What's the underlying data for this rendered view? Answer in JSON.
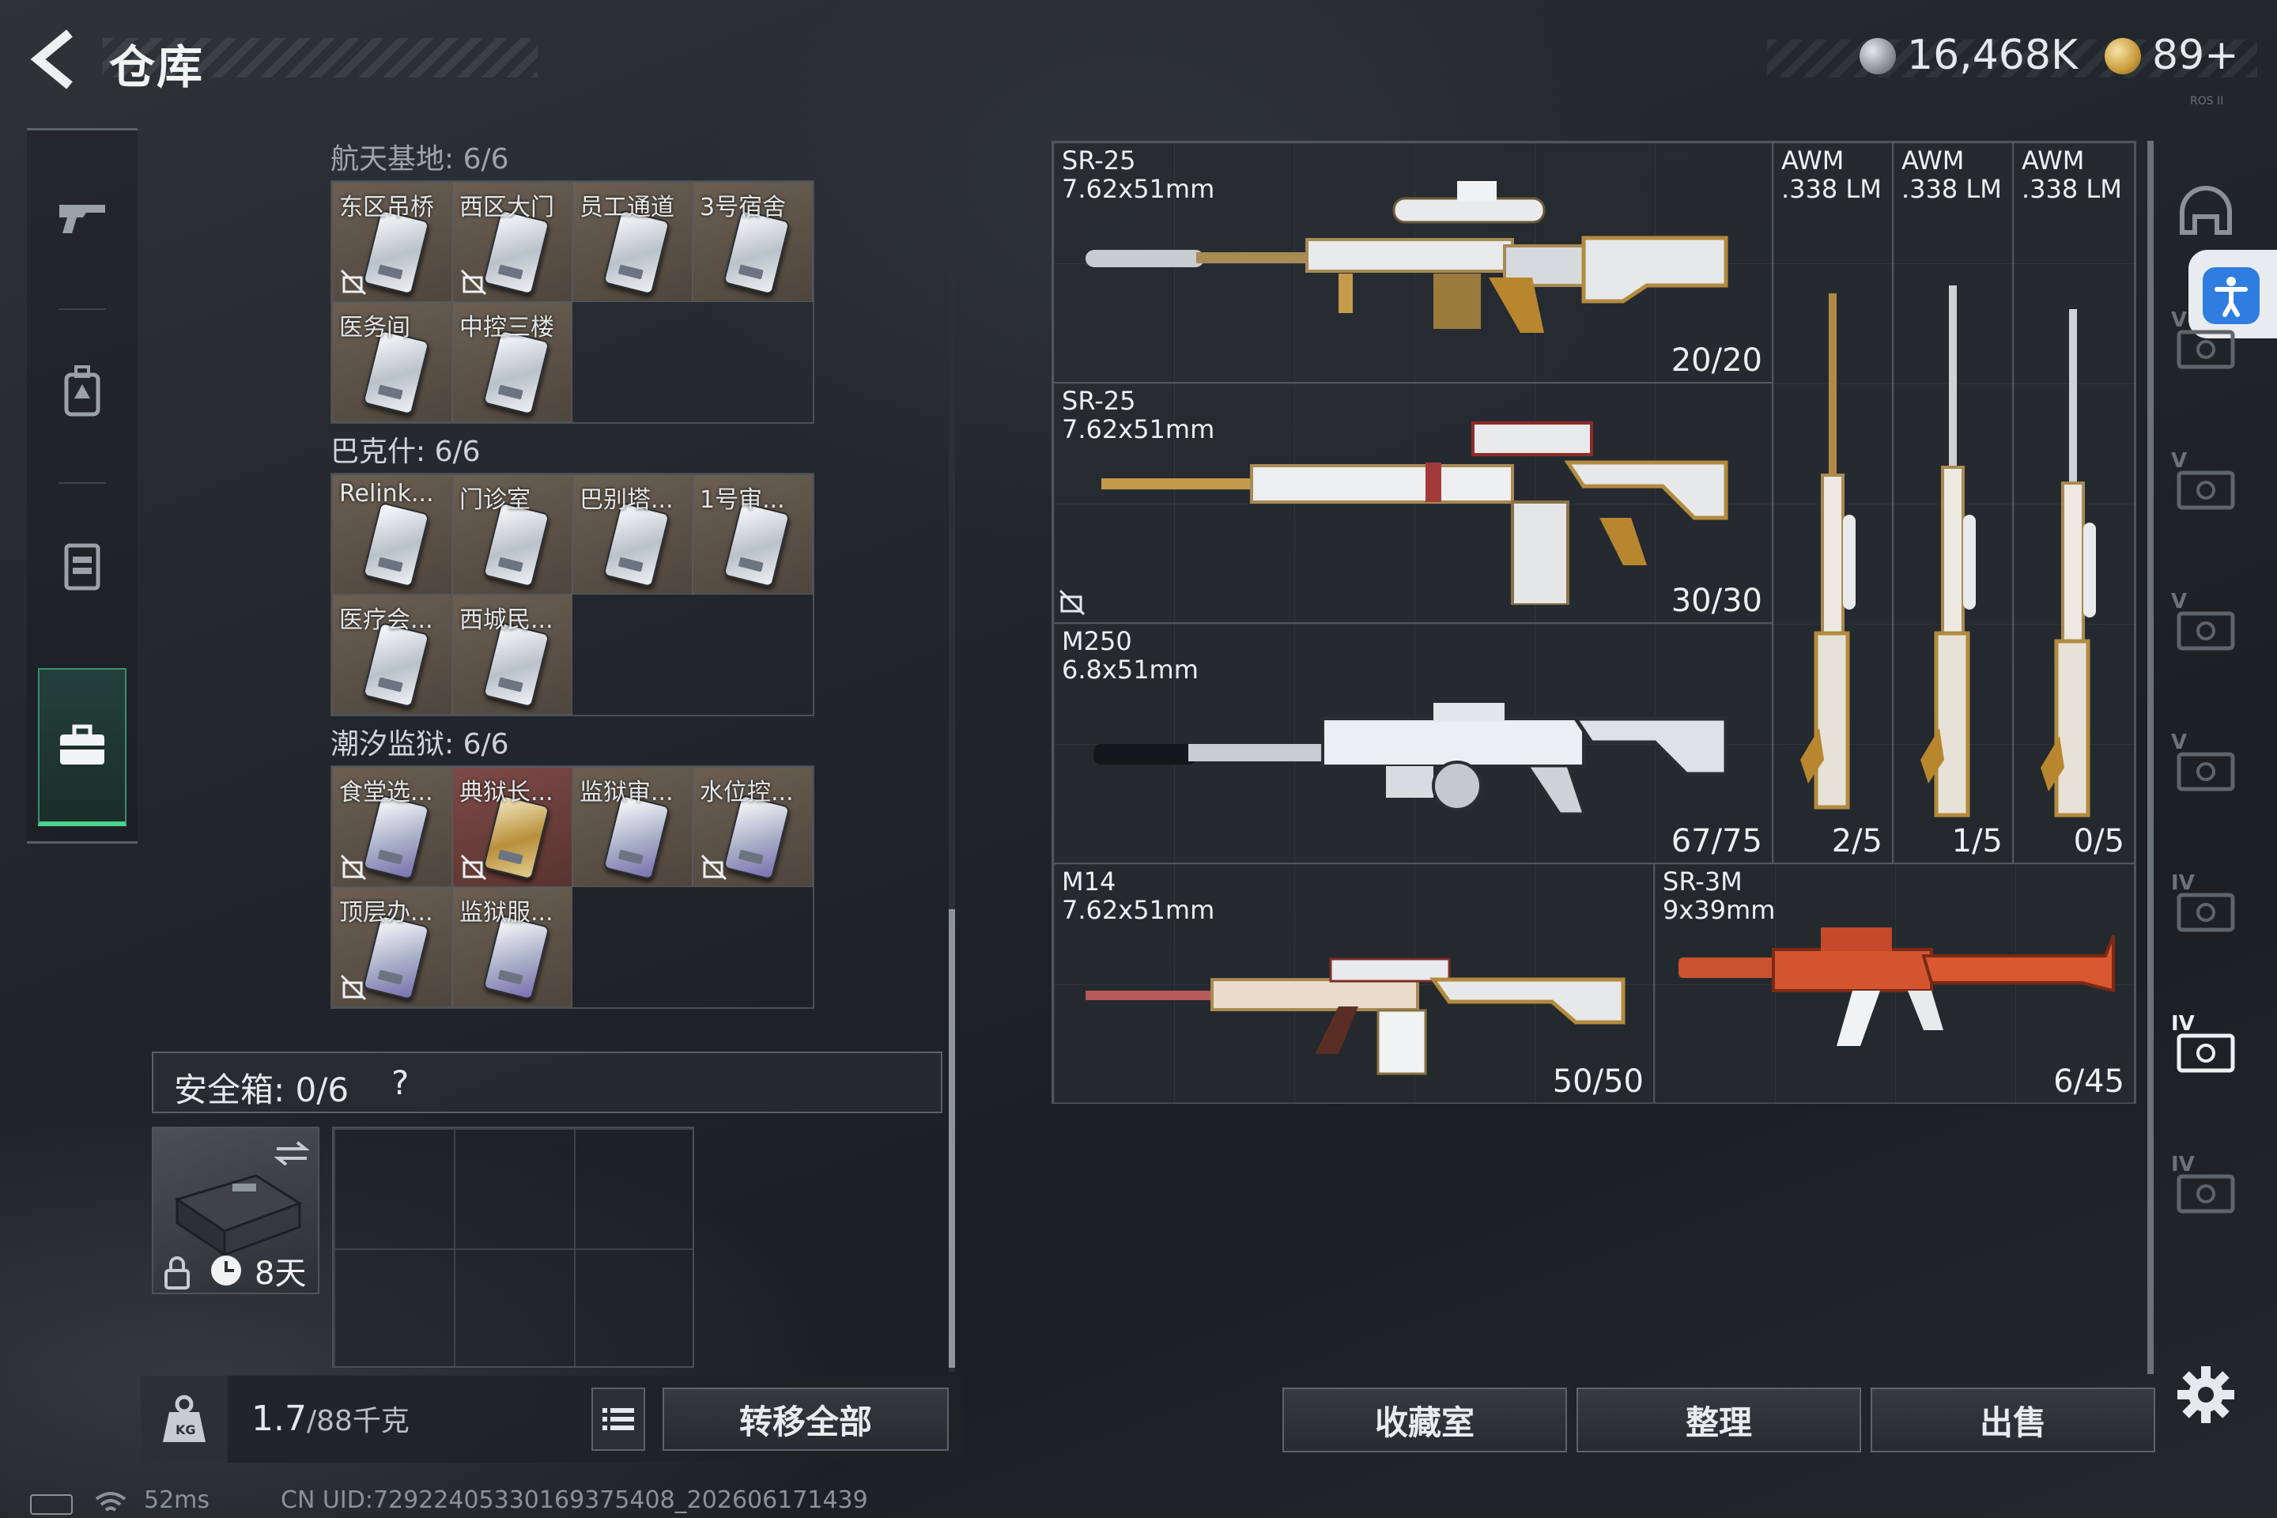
{
  "header": {
    "title": "仓库",
    "currency_main": "16,468K",
    "currency_premium": "89+",
    "small_code": "ROS II"
  },
  "nav": {
    "items": [
      "gun-icon",
      "backpack-icon",
      "vest-icon",
      "briefcase-icon"
    ],
    "active": "briefcase-icon"
  },
  "stash": {
    "sections": [
      {
        "title": "航天基地: 6/6",
        "keys": [
          {
            "label": "东区吊桥",
            "card": "white",
            "bg": "brown",
            "nosym": true
          },
          {
            "label": "西区大门",
            "card": "white",
            "bg": "brown",
            "nosym": true
          },
          {
            "label": "员工通道",
            "card": "white",
            "bg": "brown",
            "nosym": false
          },
          {
            "label": "3号宿舍",
            "card": "white",
            "bg": "brown",
            "nosym": false
          },
          {
            "label": "医务间",
            "card": "white",
            "bg": "brown",
            "nosym": false
          },
          {
            "label": "中控三楼",
            "card": "white",
            "bg": "brown",
            "nosym": false
          }
        ]
      },
      {
        "title": "巴克什: 6/6",
        "keys": [
          {
            "label": "Relink...",
            "card": "white",
            "bg": "brown",
            "nosym": false
          },
          {
            "label": "门诊室",
            "card": "white",
            "bg": "brown",
            "nosym": false
          },
          {
            "label": "巴别塔...",
            "card": "white",
            "bg": "brown",
            "nosym": false
          },
          {
            "label": "1号审...",
            "card": "white",
            "bg": "brown",
            "nosym": false
          },
          {
            "label": "医疗会...",
            "card": "white",
            "bg": "brown",
            "nosym": false
          },
          {
            "label": "西城民...",
            "card": "white",
            "bg": "brown",
            "nosym": false
          }
        ]
      },
      {
        "title": "潮汐监狱: 6/6",
        "keys": [
          {
            "label": "食堂选...",
            "card": "purple",
            "bg": "brown",
            "nosym": true
          },
          {
            "label": "典狱长...",
            "card": "gold",
            "bg": "red",
            "nosym": true
          },
          {
            "label": "监狱审...",
            "card": "purple",
            "bg": "brown",
            "nosym": false
          },
          {
            "label": "水位控...",
            "card": "purple",
            "bg": "brown",
            "nosym": true
          },
          {
            "label": "顶层办...",
            "card": "purple",
            "bg": "brown",
            "nosym": true
          },
          {
            "label": "监狱服...",
            "card": "purple",
            "bg": "brown",
            "nosym": false
          }
        ]
      }
    ],
    "secure_box": {
      "label": "安全箱: 0/6",
      "help": "?",
      "timer": "8天"
    },
    "weight": {
      "value": "1.7",
      "max": "/88千克"
    },
    "transfer_all": "转移全部"
  },
  "weapons": [
    {
      "name": "SR-25",
      "caliber": "7.62x51mm",
      "ammo": "20/20",
      "style": "gold"
    },
    {
      "name": "SR-25",
      "caliber": "7.62x51mm",
      "ammo": "30/30",
      "style": "gold"
    },
    {
      "name": "M250",
      "caliber": "6.8x51mm",
      "ammo": "67/75",
      "style": "white"
    },
    {
      "name": "M14",
      "caliber": "7.62x51mm",
      "ammo": "50/50",
      "style": "gold"
    },
    {
      "name": "SR-3M",
      "caliber": "9x39mm",
      "ammo": "6/45",
      "style": "red"
    },
    {
      "name": "AWM",
      "caliber": ".338 LM",
      "ammo": "2/5",
      "style": "gold"
    },
    {
      "name": "AWM",
      "caliber": ".338 LM",
      "ammo": "1/5",
      "style": "gold"
    },
    {
      "name": "AWM",
      "caliber": ".338 LM",
      "ammo": "0/5",
      "style": "gold"
    }
  ],
  "right_sidebar": {
    "tiers": [
      "V",
      "V",
      "V",
      "V",
      "IV",
      "IV",
      "IV"
    ]
  },
  "actions": {
    "collection": "收藏室",
    "organize": "整理",
    "sell": "出售"
  },
  "status": {
    "ping": "52ms",
    "uid": "CN UID:72922405330169375408_202606171439"
  },
  "colors": {
    "accent_green": "#48d38f",
    "gold_coin": "#c99b3a",
    "silver_coin": "#8a9096",
    "accessibility_blue": "#2f7de1"
  }
}
